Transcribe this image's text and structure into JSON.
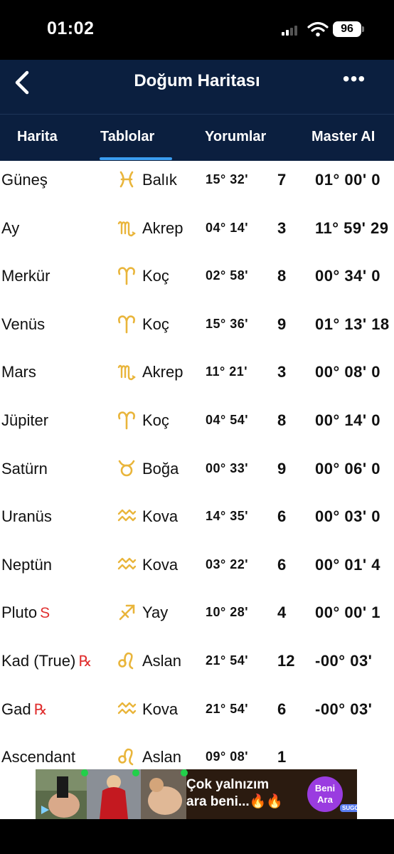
{
  "status_bar": {
    "time": "01:02",
    "battery": "96"
  },
  "nav": {
    "title": "Doğum Haritası",
    "back_icon": "chevron-left-icon",
    "more_icon": "more-dots-icon",
    "more_glyph": "•••"
  },
  "tabs": [
    {
      "label": "Harita",
      "active": false
    },
    {
      "label": "Tablolar",
      "active": true
    },
    {
      "label": "Yorumlar",
      "active": false
    },
    {
      "label": "Master AI",
      "active": false
    }
  ],
  "colors": {
    "navy": "#0b1f3f",
    "accent": "#3b9df0",
    "sign_gold": "#e9b53b",
    "marker_red": "#e03030"
  },
  "rows": [
    {
      "planet": "Güneş",
      "marker": "",
      "sign_icon": "pisces-icon",
      "sign": "Balık",
      "degree": "15° 32'",
      "house": "7",
      "motion": "01° 00' 0"
    },
    {
      "planet": "Ay",
      "marker": "",
      "sign_icon": "scorpio-icon",
      "sign": "Akrep",
      "degree": "04° 14'",
      "house": "3",
      "motion": "11° 59' 29"
    },
    {
      "planet": "Merkür",
      "marker": "",
      "sign_icon": "aries-icon",
      "sign": "Koç",
      "degree": "02° 58'",
      "house": "8",
      "motion": "00° 34' 0"
    },
    {
      "planet": "Venüs",
      "marker": "",
      "sign_icon": "aries-icon",
      "sign": "Koç",
      "degree": "15° 36'",
      "house": "9",
      "motion": "01° 13' 18"
    },
    {
      "planet": "Mars",
      "marker": "",
      "sign_icon": "scorpio-icon",
      "sign": "Akrep",
      "degree": "11° 21'",
      "house": "3",
      "motion": "00° 08' 0"
    },
    {
      "planet": "Jüpiter",
      "marker": "",
      "sign_icon": "aries-icon",
      "sign": "Koç",
      "degree": "04° 54'",
      "house": "8",
      "motion": "00° 14' 0"
    },
    {
      "planet": "Satürn",
      "marker": "",
      "sign_icon": "taurus-icon",
      "sign": "Boğa",
      "degree": "00° 33'",
      "house": "9",
      "motion": "00° 06' 0"
    },
    {
      "planet": "Uranüs",
      "marker": "",
      "sign_icon": "aquarius-icon",
      "sign": "Kova",
      "degree": "14° 35'",
      "house": "6",
      "motion": "00° 03' 0"
    },
    {
      "planet": "Neptün",
      "marker": "",
      "sign_icon": "aquarius-icon",
      "sign": "Kova",
      "degree": "03° 22'",
      "house": "6",
      "motion": "00° 01' 4"
    },
    {
      "planet": "Pluto",
      "marker": "S",
      "sign_icon": "sagittarius-icon",
      "sign": "Yay",
      "degree": "10° 28'",
      "house": "4",
      "motion": "00° 00' 1"
    },
    {
      "planet": "Kad (True)",
      "marker": "℞",
      "sign_icon": "leo-icon",
      "sign": "Aslan",
      "degree": "21° 54'",
      "house": "12",
      "motion": "-00° 03'"
    },
    {
      "planet": "Gad",
      "marker": "℞",
      "sign_icon": "aquarius-icon",
      "sign": "Kova",
      "degree": "21° 54'",
      "house": "6",
      "motion": "-00° 03'"
    },
    {
      "planet": "Ascendant",
      "marker": "",
      "sign_icon": "leo-icon",
      "sign": "Aslan",
      "degree": "09° 08'",
      "house": "1",
      "motion": ""
    }
  ],
  "ad": {
    "text_line1": "Çok yalnızım",
    "text_line2": "ara beni...🔥🔥",
    "cta_line1": "Beni",
    "cta_line2": "Ara",
    "brand": "SUGO"
  }
}
